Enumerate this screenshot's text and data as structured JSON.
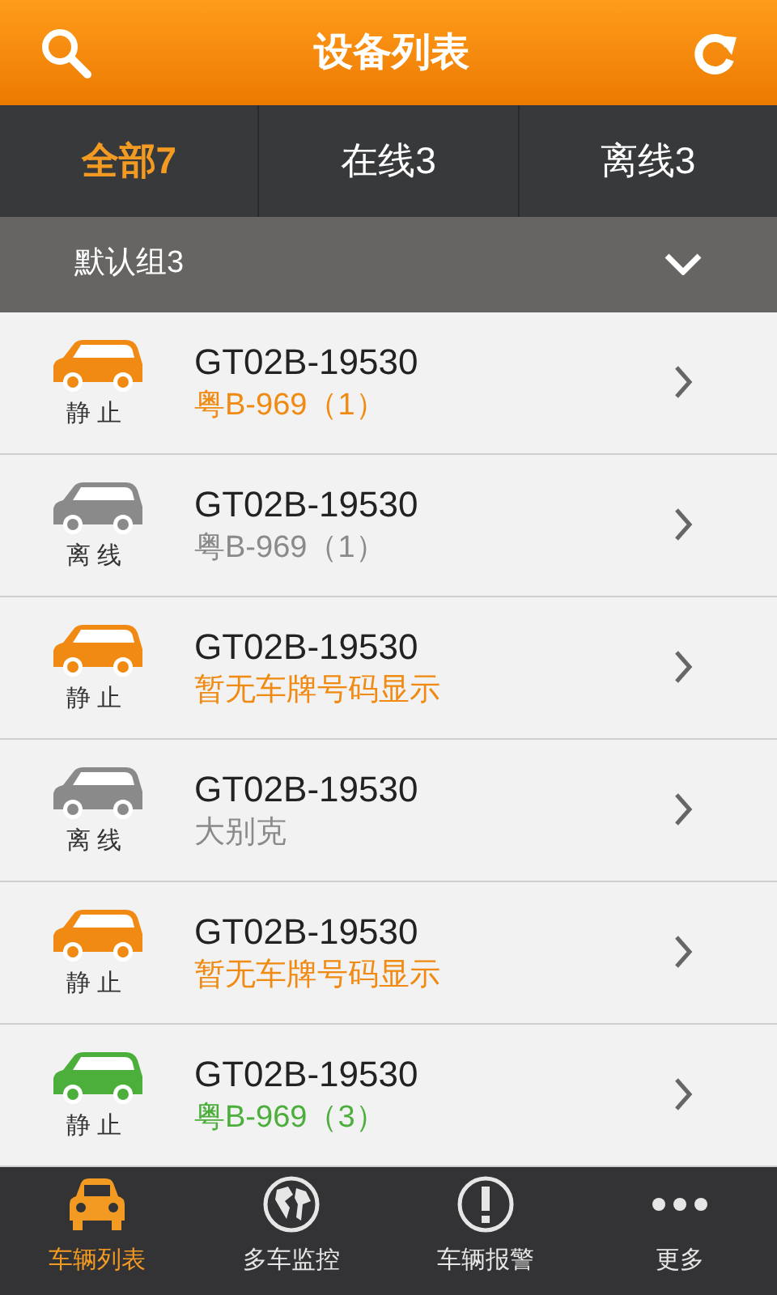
{
  "header": {
    "title": "设备列表"
  },
  "tabs": [
    {
      "label": "全部7",
      "selected": true
    },
    {
      "label": "在线3",
      "selected": false
    },
    {
      "label": "离线3",
      "selected": false
    }
  ],
  "group": {
    "label": "默认组3",
    "expanded": true
  },
  "devices": [
    {
      "status": "静止",
      "name": "GT02B-19530",
      "plate": "粤B-969（1）",
      "color": "#f08a12"
    },
    {
      "status": "离线",
      "name": "GT02B-19530",
      "plate": "粤B-969（1）",
      "color": "#8a8a8a"
    },
    {
      "status": "静止",
      "name": "GT02B-19530",
      "plate": "暂无车牌号码显示",
      "color": "#f08a12"
    },
    {
      "status": "离线",
      "name": "GT02B-19530",
      "plate": "大别克",
      "color": "#8a8a8a"
    },
    {
      "status": "静止",
      "name": "GT02B-19530",
      "plate": "暂无车牌号码显示",
      "color": "#f08a12"
    },
    {
      "status": "静止",
      "name": "GT02B-19530",
      "plate": "粤B-969（3）",
      "color": "#4caf3c"
    }
  ],
  "nav": [
    {
      "kind": "car",
      "label": "车辆列表",
      "selected": true
    },
    {
      "kind": "globe",
      "label": "多车监控",
      "selected": false
    },
    {
      "kind": "alert",
      "label": "车辆报警",
      "selected": false
    },
    {
      "kind": "more",
      "label": "更多",
      "selected": false
    }
  ]
}
